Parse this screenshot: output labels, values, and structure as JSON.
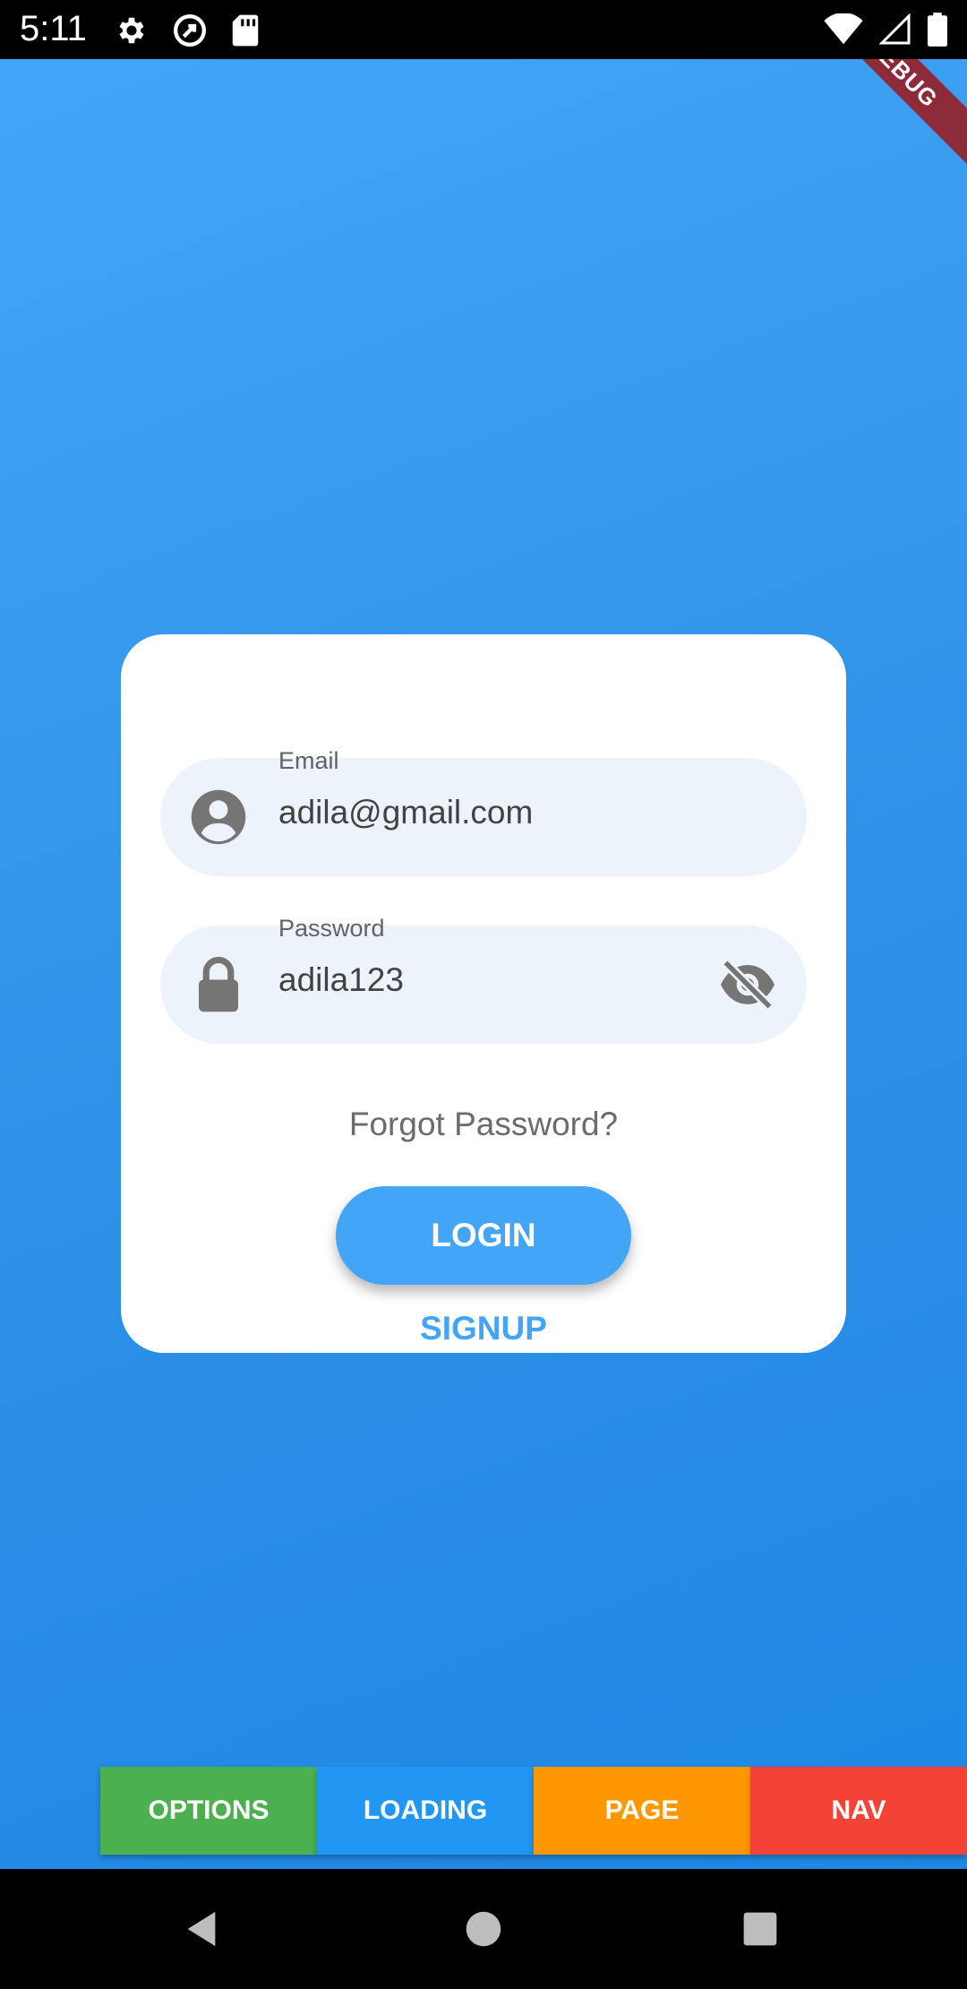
{
  "status_bar": {
    "time": "5:11",
    "icons_left": [
      "settings-icon",
      "vpn-icon",
      "sd-card-icon"
    ],
    "icons_right": [
      "wifi-icon",
      "signal-icon",
      "battery-icon"
    ]
  },
  "debug_banner": "DEBUG",
  "login_card": {
    "email": {
      "label": "Email",
      "value": "adila@gmail.com",
      "icon": "person-icon"
    },
    "password": {
      "label": "Password",
      "value": "adila123",
      "icon": "lock-icon",
      "toggle_icon": "eye-off-icon"
    },
    "forgot_password": "Forgot Password?",
    "login_button": "LOGIN",
    "signup_link": "SIGNUP"
  },
  "bottom_tabs": [
    {
      "label": "OPTIONS",
      "color": "#4caf50"
    },
    {
      "label": "LOADING",
      "color": "#2196f3"
    },
    {
      "label": "PAGE",
      "color": "#ff9800"
    },
    {
      "label": "NAV",
      "color": "#f44336"
    }
  ],
  "colors": {
    "primary": "#42a5f5",
    "field_background": "#edf3fa"
  }
}
